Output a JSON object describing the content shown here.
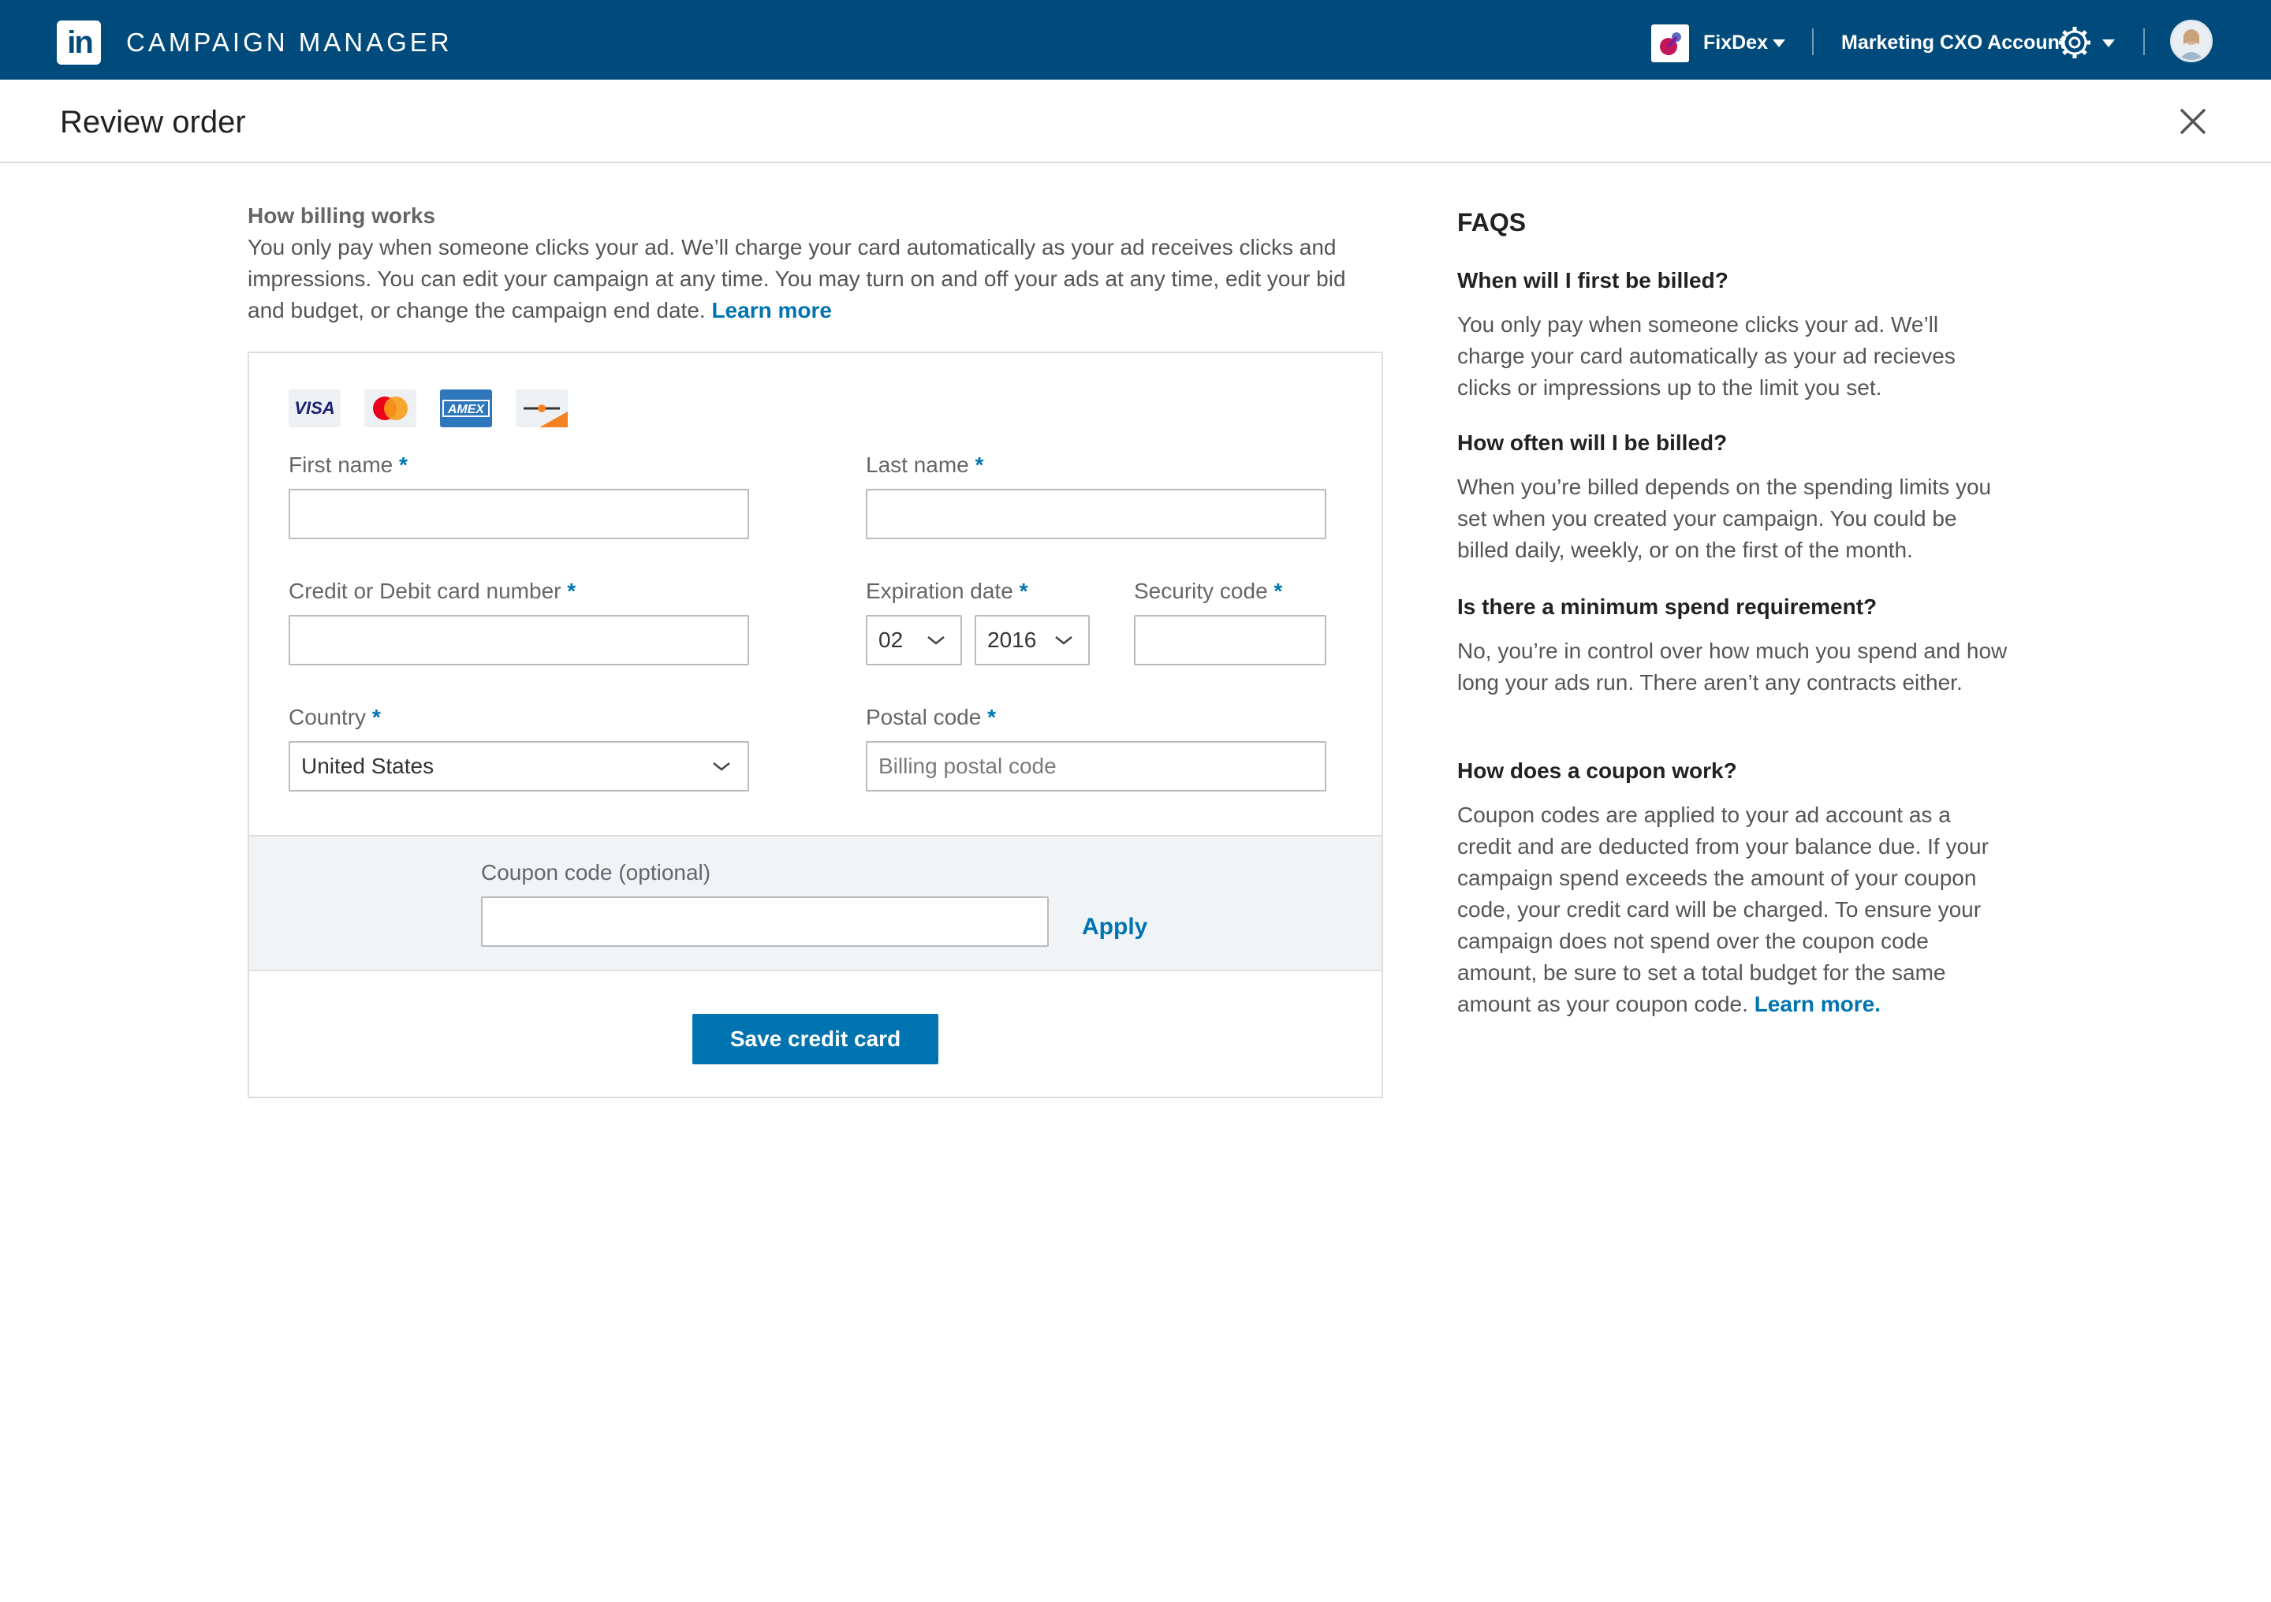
{
  "topbar": {
    "logo_text": "in",
    "app_title": "CAMPAIGN MANAGER",
    "company_name": "FixDex",
    "account_name": "Marketing CXO Account"
  },
  "header": {
    "title": "Review order"
  },
  "billing": {
    "heading": "How billing works",
    "body": "You only pay when someone clicks your ad. We’ll charge your card automatically as your ad receives clicks and impressions. You can edit your campaign at any time.  You  may turn on and off your ads at any time, edit your bid and budget, or change the campaign end date.",
    "learn_more": "Learn more"
  },
  "card_icons": [
    "visa-icon",
    "mastercard-icon",
    "amex-icon",
    "discover-icon"
  ],
  "form": {
    "first_name_label": "First name",
    "last_name_label": "Last name",
    "card_number_label": "Credit or Debit card number",
    "expiration_label": "Expiration date",
    "security_label": "Security code",
    "country_label": "Country",
    "postal_label": "Postal code",
    "required_mark": "*",
    "expiration_month": "02",
    "expiration_year": "2016",
    "country_value": "United States",
    "postal_placeholder": "Billing postal code",
    "first_name_value": "",
    "last_name_value": "",
    "card_number_value": "",
    "security_value": "",
    "coupon_label": "Coupon code (optional)",
    "coupon_value": "",
    "apply_label": "Apply",
    "save_label": "Save credit card"
  },
  "faq": {
    "title": "FAQS",
    "items": [
      {
        "question": "When will I first be billed?",
        "answer": "You only pay when someone clicks your ad. We’ll charge your card automatically as your ad recieves clicks or impressions up to the limit you set."
      },
      {
        "question": "How often will I be billed?",
        "answer": "When you’re billed depends on the spending limits you set when you created your campaign. You could be billed daily, weekly, or on the first of the month."
      },
      {
        "question": "Is there a minimum spend requirement?",
        "answer": "No, you’re in control over how much you spend and how long your ads run. There aren’t any contracts either."
      },
      {
        "question": "How does a coupon work?",
        "answer": "Coupon codes are applied to your ad account as a credit and are deducted from your balance due. If your campaign spend exceeds the amount of your coupon code, your credit card will be charged. To ensure your campaign does not spend over the coupon code amount, be sure to set a total budget for the same amount as your coupon code.",
        "learn_more": "Learn more."
      }
    ]
  },
  "colors": {
    "topbar": "#004b7c",
    "accent": "#0073b1",
    "coupon_bg": "#f1f4f6"
  }
}
